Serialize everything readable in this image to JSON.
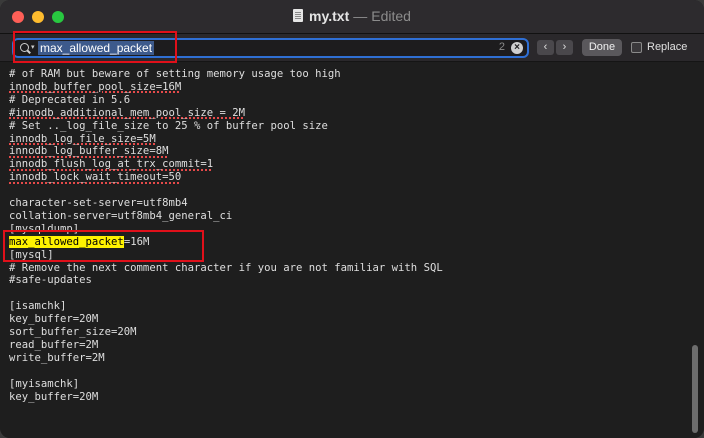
{
  "window": {
    "file_name": "my.txt",
    "separator": "—",
    "status": "Edited"
  },
  "find_bar": {
    "query": "max_allowed_packet",
    "match_count": "2",
    "prev_icon": "chevron-left-icon",
    "next_icon": "chevron-right-icon",
    "done_label": "Done",
    "replace_label": "Replace",
    "replace_checked": false
  },
  "editor": {
    "lines": [
      {
        "text": "# of RAM but beware of setting memory usage too high"
      },
      {
        "text": "innodb_buffer_pool_size=16M",
        "spell": true
      },
      {
        "text": "# Deprecated in 5.6"
      },
      {
        "text": "#innodb_additional_mem_pool_size = 2M",
        "spell": true
      },
      {
        "text": "# Set .._log_file_size to 25 % of buffer pool size"
      },
      {
        "text": "innodb_log_file_size=5M",
        "spell": true
      },
      {
        "text": "innodb_log_buffer_size=8M",
        "spell": true
      },
      {
        "text": "innodb_flush_log_at_trx_commit=1",
        "spell": true
      },
      {
        "text": "innodb_lock_wait_timeout=50",
        "spell": true
      },
      {
        "text": ""
      },
      {
        "text": "character-set-server=utf8mb4"
      },
      {
        "text": "collation-server=utf8mb4_general_ci"
      },
      {
        "text": "[mysqldump]"
      },
      {
        "text": "=16M",
        "highlight": "max_allowed_packet"
      },
      {
        "text": "[mysql]"
      },
      {
        "text": "# Remove the next comment character if you are not familiar with SQL"
      },
      {
        "text": "#safe-updates"
      },
      {
        "text": ""
      },
      {
        "text": "[isamchk]"
      },
      {
        "text": "key_buffer=20M"
      },
      {
        "text": "sort_buffer_size=20M"
      },
      {
        "text": "read_buffer=2M"
      },
      {
        "text": "write_buffer=2M"
      },
      {
        "text": ""
      },
      {
        "text": "[myisamchk]"
      },
      {
        "text": "key_buffer=20M"
      }
    ]
  },
  "colors": {
    "highlight": "#fff200",
    "annotation_box": "#e0101a",
    "search_focus": "#2f6fd4"
  }
}
